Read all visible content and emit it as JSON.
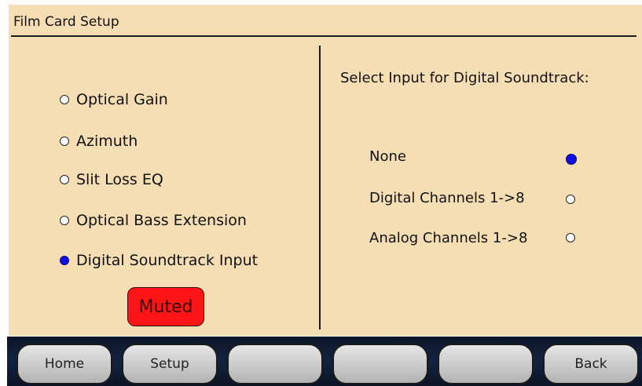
{
  "title": "Film Card Setup",
  "left_options": [
    {
      "label": "Optical Gain",
      "selected": false
    },
    {
      "label": "Azimuth",
      "selected": false
    },
    {
      "label": "Slit Loss EQ",
      "selected": false
    },
    {
      "label": "Optical Bass Extension",
      "selected": false
    },
    {
      "label": "Digital Soundtrack Input",
      "selected": true
    }
  ],
  "muted_label": "Muted",
  "right": {
    "prompt": "Select Input for Digital Soundtrack:",
    "options": [
      {
        "label": "None",
        "selected": true
      },
      {
        "label": "Digital Channels 1->8",
        "selected": false
      },
      {
        "label": "Analog Channels 1->8",
        "selected": false
      }
    ]
  },
  "nav": {
    "home": "Home",
    "setup": "Setup",
    "blank1": "",
    "blank2": "",
    "blank3": "",
    "back": "Back"
  },
  "colors": {
    "panel": "#f5deb3",
    "selected_radio": "#1010e0",
    "muted": "#ff1515",
    "nav_bar": "#132340"
  }
}
